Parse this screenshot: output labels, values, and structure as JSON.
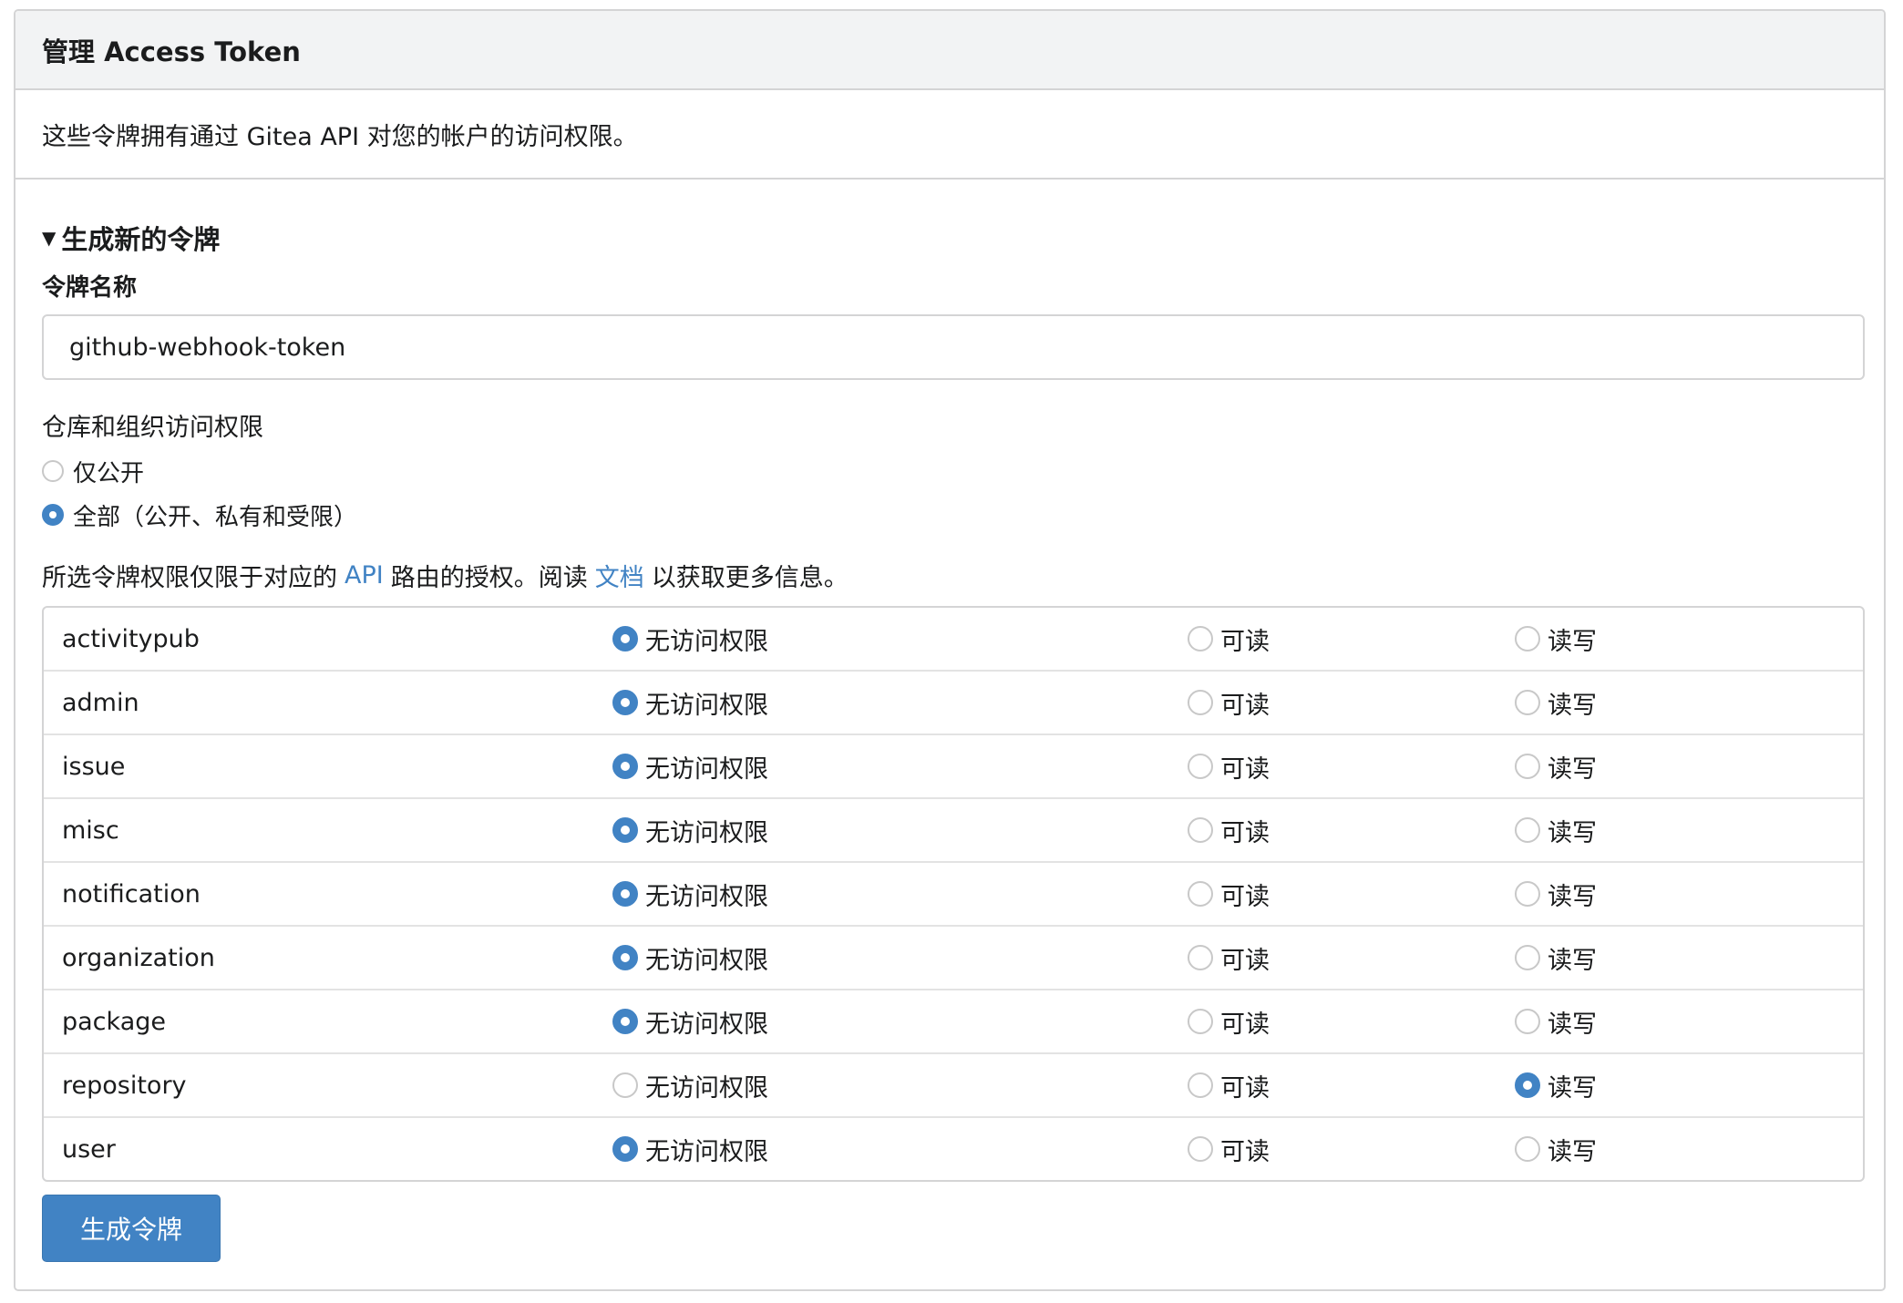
{
  "panel": {
    "title": "管理 Access Token",
    "description": "这些令牌拥有通过 Gitea API 对您的帐户的访问权限。"
  },
  "form": {
    "summary_label": "生成新的令牌",
    "token_name_label": "令牌名称",
    "token_name_value": "github-webhook-token",
    "repo_access_label": "仓库和组织访问权限",
    "repo_access_options": [
      {
        "label": "仅公开",
        "checked": false
      },
      {
        "label": "全部（公开、私有和受限）",
        "checked": true
      }
    ],
    "help_prefix": "所选令牌权限仅限于对应的",
    "help_api_link": "API",
    "help_middle": "路由的授权。阅读",
    "help_docs_link": "文档",
    "help_suffix": "以获取更多信息。",
    "scope_option_labels": [
      "无访问权限",
      "可读",
      "读写"
    ],
    "scopes": [
      {
        "name": "activitypub",
        "selected": "无访问权限"
      },
      {
        "name": "admin",
        "selected": "无访问权限"
      },
      {
        "name": "issue",
        "selected": "无访问权限"
      },
      {
        "name": "misc",
        "selected": "无访问权限"
      },
      {
        "name": "notification",
        "selected": "无访问权限"
      },
      {
        "name": "organization",
        "selected": "无访问权限"
      },
      {
        "name": "package",
        "selected": "无访问权限"
      },
      {
        "name": "repository",
        "selected": "读写"
      },
      {
        "name": "user",
        "selected": "无访问权限"
      }
    ],
    "submit_label": "生成令牌"
  },
  "colors": {
    "accent": "#4183c4",
    "header_bg": "#f2f3f4",
    "border": "#d4d4d5"
  }
}
